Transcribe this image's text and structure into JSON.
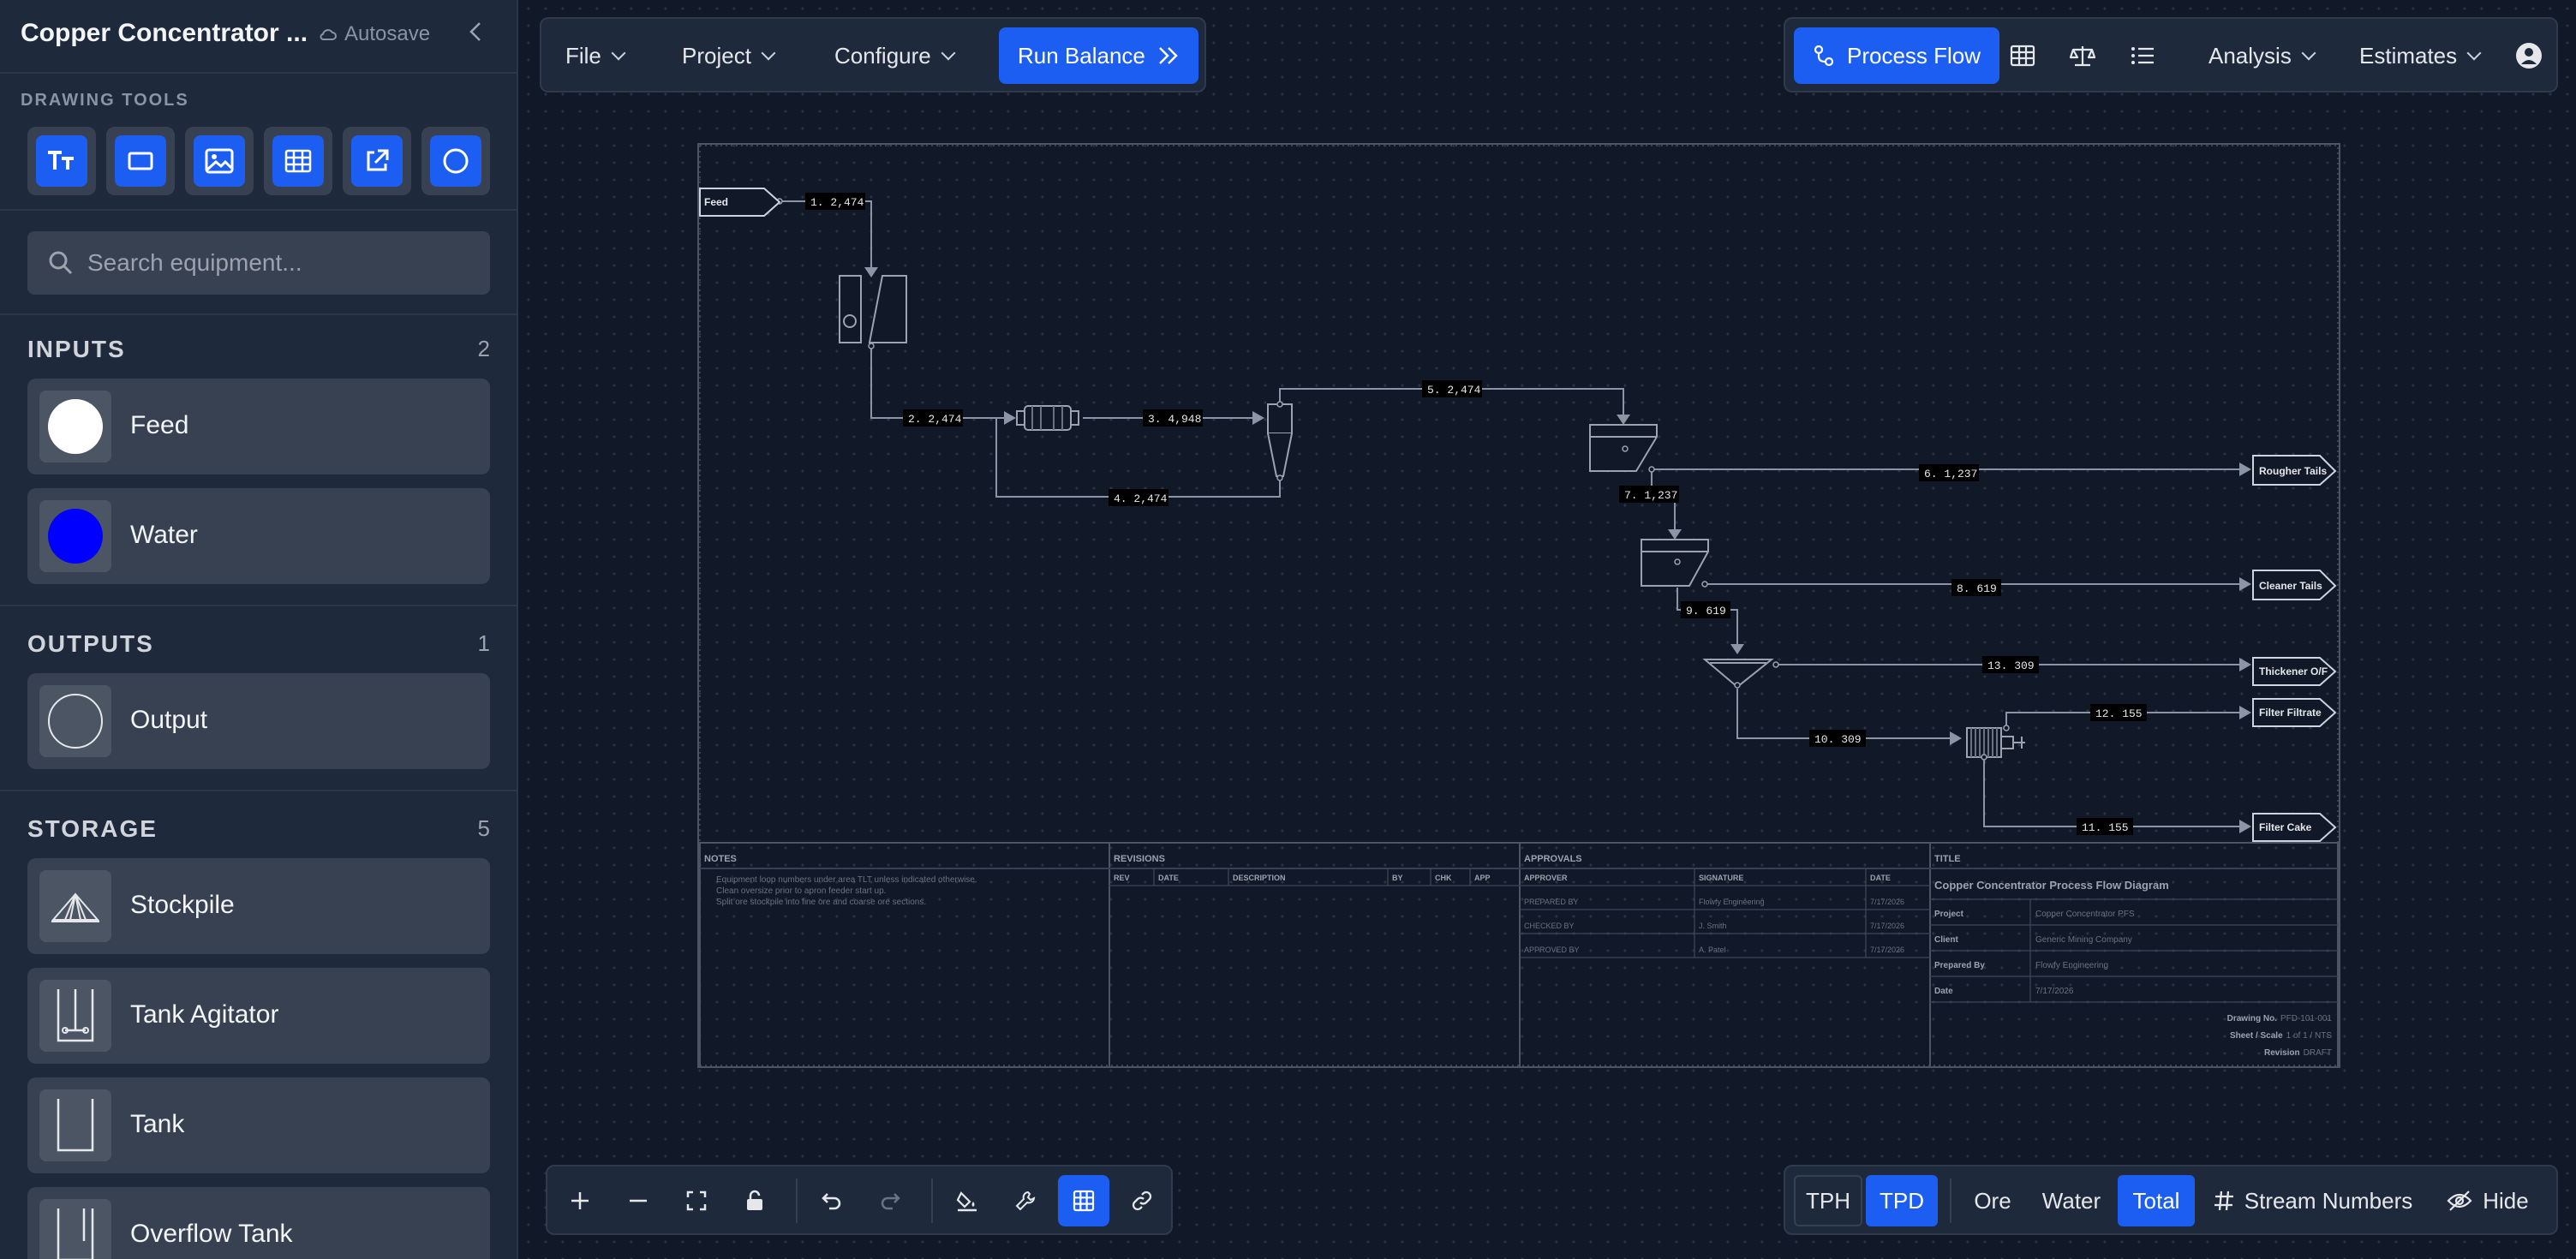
{
  "sidebar": {
    "project_title": "Copper Concentrator ...",
    "autosave": "Autosave",
    "drawing_tools_label": "DRAWING TOOLS",
    "tools": [
      "text-tool-icon",
      "rectangle-tool-icon",
      "image-tool-icon",
      "table-tool-icon",
      "external-link-tool-icon",
      "circle-tool-icon"
    ],
    "search_placeholder": "Search equipment...",
    "inputs": {
      "title": "INPUTS",
      "count": "2",
      "items": [
        {
          "label": "Feed",
          "color": "#ffffff"
        },
        {
          "label": "Water",
          "color": "#0000ff"
        }
      ]
    },
    "outputs": {
      "title": "OUTPUTS",
      "count": "1",
      "items": [
        {
          "label": "Output"
        }
      ]
    },
    "storage": {
      "title": "STORAGE",
      "count": "5",
      "items": [
        {
          "label": "Stockpile"
        },
        {
          "label": "Tank Agitator"
        },
        {
          "label": "Tank"
        },
        {
          "label": "Overflow Tank"
        }
      ]
    }
  },
  "topbar": {
    "file": "File",
    "project": "Project",
    "configure": "Configure",
    "run_balance": "Run Balance",
    "process_flow": "Process Flow",
    "analysis": "Analysis",
    "estimates": "Estimates"
  },
  "diagram": {
    "terminals": {
      "feed": "Feed",
      "rougher_tails": "Rougher Tails",
      "cleaner_tails": "Cleaner Tails",
      "thickener_of": "Thickener O/F",
      "filter_filtrate": "Filter Filtrate",
      "filter_cake": "Filter Cake"
    },
    "streams": [
      "1. 2,474",
      "2. 2,474",
      "3. 4,948",
      "4. 2,474",
      "5. 2,474",
      "6. 1,237",
      "7. 1,237",
      "8. 619",
      "9. 619",
      "10. 309",
      "11. 155",
      "12. 155",
      "13. 309"
    ],
    "title_block": {
      "notes_header": "NOTES",
      "notes": [
        "Equipment loop numbers under area TLT unless indicated otherwise.",
        "Clean oversize prior to apron feeder start up.",
        "Split ore stockpile into fine ore and coarse ore sections."
      ],
      "revisions_header": "REVISIONS",
      "revision_cols": [
        "REV",
        "DATE",
        "DESCRIPTION",
        "BY",
        "CHK",
        "APP"
      ],
      "approvals_header": "APPROVALS",
      "approval_cols": [
        "APPROVER",
        "SIGNATURE",
        "DATE"
      ],
      "approvals": [
        [
          "PREPARED BY",
          "Flowfy Engineering",
          "7/17/2026"
        ],
        [
          "CHECKED BY",
          "J. Smith",
          "7/17/2026"
        ],
        [
          "APPROVED BY",
          "A. Patel",
          "7/17/2026"
        ]
      ],
      "title_header": "TITLE",
      "title": "Copper Concentrator Process Flow Diagram",
      "fields": [
        [
          "Project",
          "Copper Concentrator PFS"
        ],
        [
          "Client",
          "Generic Mining Company"
        ],
        [
          "Prepared By",
          "Flowfy Engineering"
        ],
        [
          "Date",
          "7/17/2026"
        ]
      ],
      "drawing_no_label": "Drawing No.",
      "drawing_no": "PFD-101-001",
      "sheet_label": "Sheet / Scale",
      "sheet": "1 of 1 / NTS",
      "revision_label": "Revision",
      "revision": "DRAFT"
    }
  },
  "bottom": {
    "units": [
      "TPH",
      "TPD"
    ],
    "active_unit": "TPD",
    "views": [
      "Ore",
      "Water",
      "Total"
    ],
    "active_view": "Total",
    "stream_numbers": "Stream Numbers",
    "hide": "Hide"
  }
}
